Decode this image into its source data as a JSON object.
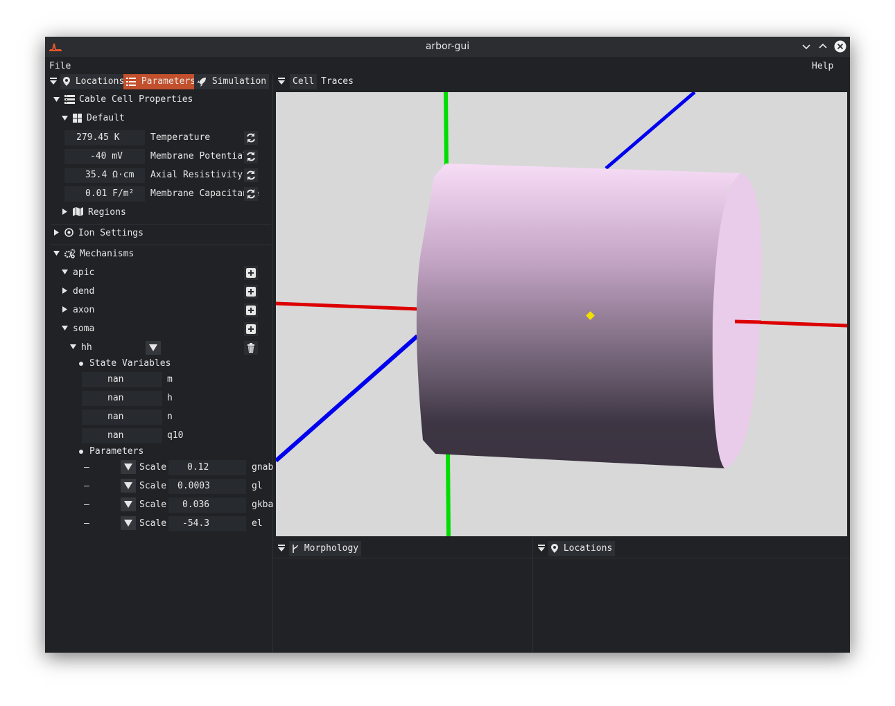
{
  "window": {
    "title": "arbor-gui"
  },
  "menubar": {
    "file": "File",
    "help": "Help"
  },
  "left_tabs": {
    "locations": "Locations",
    "parameters": "Parameters",
    "simulation": "Simulation"
  },
  "view_tabs": {
    "cell": "Cell",
    "traces": "Traces"
  },
  "cable_cell": {
    "header": "Cable Cell Properties",
    "default_label": "Default",
    "properties": [
      {
        "value": "279.45 K",
        "label": "Temperature"
      },
      {
        "value": "-40 mV",
        "label": "Membrane Potential"
      },
      {
        "value": "35.4 Ω·cm",
        "label": "Axial Resistivity"
      },
      {
        "value": "0.01 F/m²",
        "label": "Membrane Capacitance"
      }
    ],
    "regions_label": "Regions"
  },
  "ion_settings": {
    "label": "Ion Settings"
  },
  "mechanisms": {
    "header": "Mechanisms",
    "regions": [
      "apic",
      "dend",
      "axon",
      "soma"
    ],
    "mechanism_name": "hh",
    "state_variables_label": "State Variables",
    "state_variables": [
      {
        "value": "nan",
        "name": "m"
      },
      {
        "value": "nan",
        "name": "h"
      },
      {
        "value": "nan",
        "name": "n"
      },
      {
        "value": "nan",
        "name": "q10"
      }
    ],
    "parameters_label": "Parameters",
    "parameters": [
      {
        "dash": "–",
        "mode": "Scale",
        "value": "0.12",
        "name": "gnab"
      },
      {
        "dash": "–",
        "mode": "Scale",
        "value": "0.0003",
        "name": "gl"
      },
      {
        "dash": "–",
        "mode": "Scale",
        "value": "0.036",
        "name": "gkba"
      },
      {
        "dash": "–",
        "mode": "Scale",
        "value": "-54.3",
        "name": "el"
      }
    ]
  },
  "bottom_tabs": {
    "morphology": "Morphology",
    "locations": "Locations"
  },
  "colors": {
    "accent": "#c2502c",
    "window_bg": "#202225",
    "axis_x": "#dd0000",
    "axis_y": "#00dd00",
    "axis_z": "#0000ee",
    "cylinder_top": "#f8ddf7",
    "cylinder_bottom": "#3b3440",
    "center_marker": "#f1e100"
  }
}
